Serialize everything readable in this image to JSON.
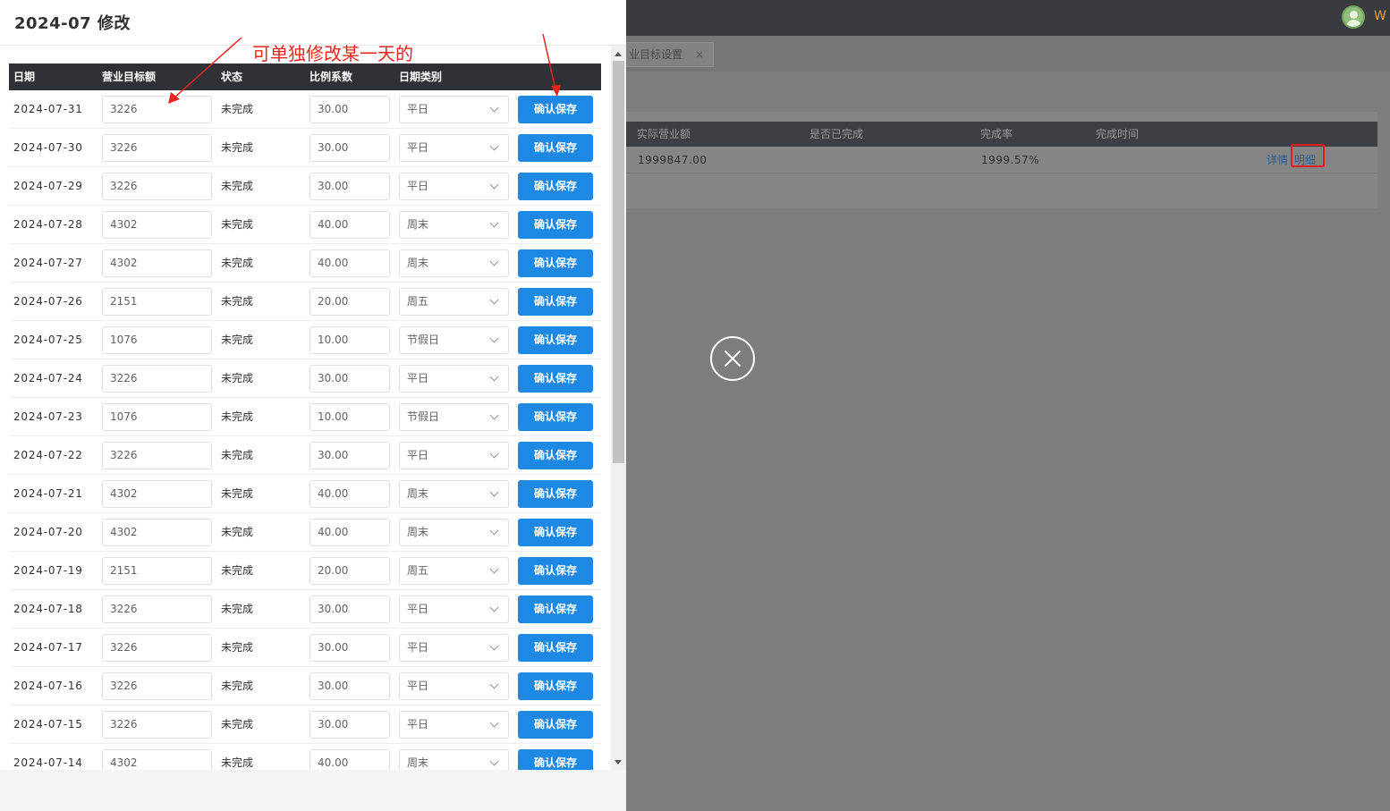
{
  "background": {
    "user_name": "W",
    "tab_label": "业目标设置",
    "tab_close": "×",
    "table_headers": [
      "实际营业额",
      "是否已完成",
      "完成率",
      "完成时间"
    ],
    "row": {
      "actual_revenue": "1999847.00",
      "completion_rate": "1999.57%",
      "detail_link": "详情",
      "breakdown_link": "明细"
    }
  },
  "modal": {
    "title": "2024-07 修改",
    "annotation": "可单独修改某一天的",
    "headers": {
      "date": "日期",
      "target": "营业目标额",
      "status": "状态",
      "ratio": "比例系数",
      "date_type": "日期类别"
    },
    "rows": [
      {
        "date": "2024-07-31",
        "target": "3226",
        "status": "未完成",
        "ratio": "30.00",
        "type": "平日",
        "button": "确认保存"
      },
      {
        "date": "2024-07-30",
        "target": "3226",
        "status": "未完成",
        "ratio": "30.00",
        "type": "平日",
        "button": "确认保存"
      },
      {
        "date": "2024-07-29",
        "target": "3226",
        "status": "未完成",
        "ratio": "30.00",
        "type": "平日",
        "button": "确认保存"
      },
      {
        "date": "2024-07-28",
        "target": "4302",
        "status": "未完成",
        "ratio": "40.00",
        "type": "周末",
        "button": "确认保存"
      },
      {
        "date": "2024-07-27",
        "target": "4302",
        "status": "未完成",
        "ratio": "40.00",
        "type": "周末",
        "button": "确认保存"
      },
      {
        "date": "2024-07-26",
        "target": "2151",
        "status": "未完成",
        "ratio": "20.00",
        "type": "周五",
        "button": "确认保存"
      },
      {
        "date": "2024-07-25",
        "target": "1076",
        "status": "未完成",
        "ratio": "10.00",
        "type": "节假日",
        "button": "确认保存"
      },
      {
        "date": "2024-07-24",
        "target": "3226",
        "status": "未完成",
        "ratio": "30.00",
        "type": "平日",
        "button": "确认保存"
      },
      {
        "date": "2024-07-23",
        "target": "1076",
        "status": "未完成",
        "ratio": "10.00",
        "type": "节假日",
        "button": "确认保存"
      },
      {
        "date": "2024-07-22",
        "target": "3226",
        "status": "未完成",
        "ratio": "30.00",
        "type": "平日",
        "button": "确认保存"
      },
      {
        "date": "2024-07-21",
        "target": "4302",
        "status": "未完成",
        "ratio": "40.00",
        "type": "周末",
        "button": "确认保存"
      },
      {
        "date": "2024-07-20",
        "target": "4302",
        "status": "未完成",
        "ratio": "40.00",
        "type": "周末",
        "button": "确认保存"
      },
      {
        "date": "2024-07-19",
        "target": "2151",
        "status": "未完成",
        "ratio": "20.00",
        "type": "周五",
        "button": "确认保存"
      },
      {
        "date": "2024-07-18",
        "target": "3226",
        "status": "未完成",
        "ratio": "30.00",
        "type": "平日",
        "button": "确认保存"
      },
      {
        "date": "2024-07-17",
        "target": "3226",
        "status": "未完成",
        "ratio": "30.00",
        "type": "平日",
        "button": "确认保存"
      },
      {
        "date": "2024-07-16",
        "target": "3226",
        "status": "未完成",
        "ratio": "30.00",
        "type": "平日",
        "button": "确认保存"
      },
      {
        "date": "2024-07-15",
        "target": "3226",
        "status": "未完成",
        "ratio": "30.00",
        "type": "平日",
        "button": "确认保存"
      },
      {
        "date": "2024-07-14",
        "target": "4302",
        "status": "未完成",
        "ratio": "40.00",
        "type": "周末",
        "button": "确认保存"
      }
    ]
  },
  "colors": {
    "primary": "#1e88e5",
    "annotation": "#e8261f",
    "header_bg": "#2f3136",
    "overlay": "#7d7d7d"
  },
  "icons": [
    "close-circle-icon",
    "chevron-down-icon",
    "avatar-icon",
    "arrow-annotation-icon"
  ]
}
